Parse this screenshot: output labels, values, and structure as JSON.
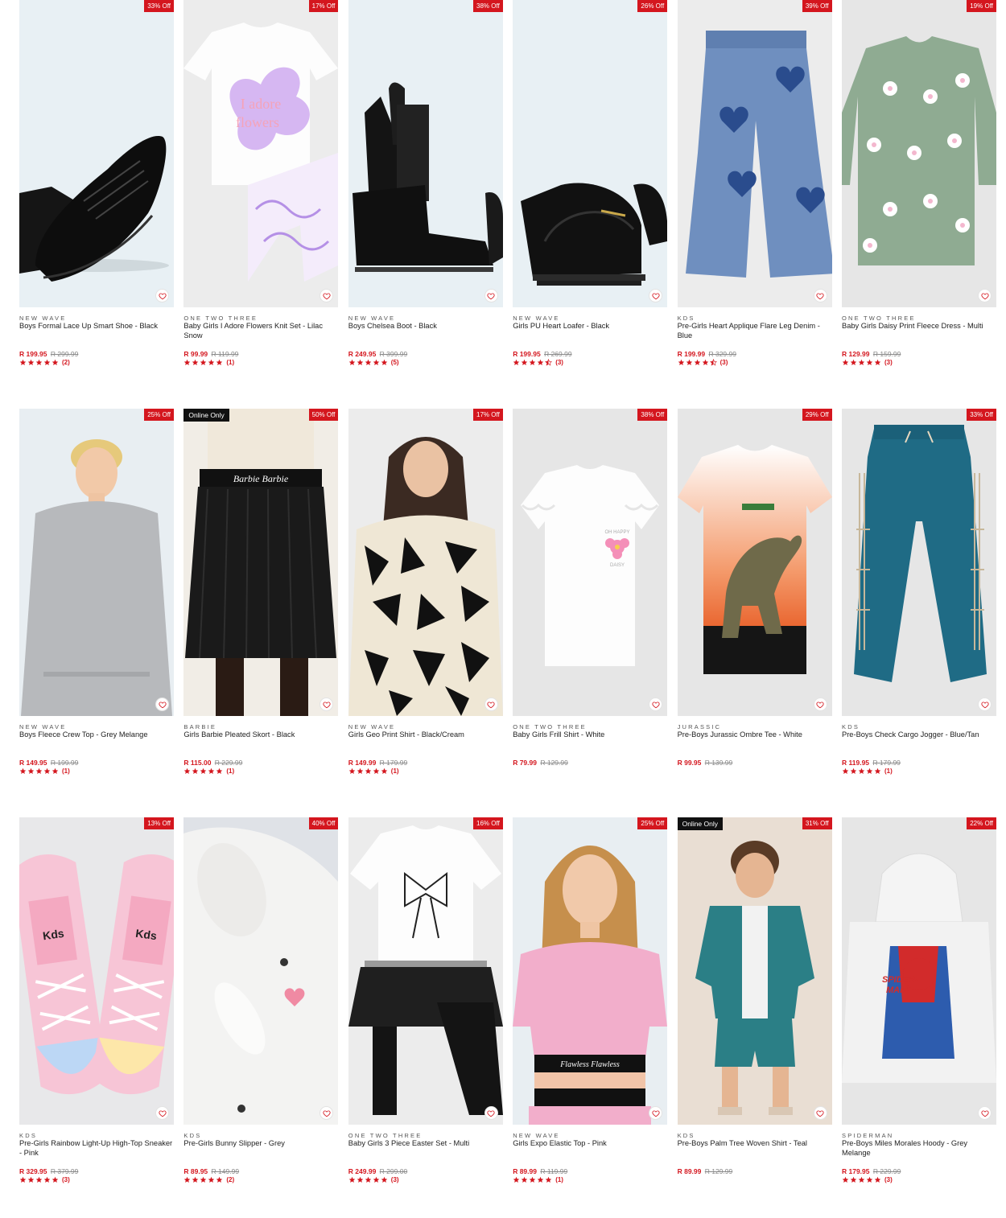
{
  "colors": {
    "accent": "#d4161e",
    "badge_dark": "#111111",
    "strike": "#888888"
  },
  "icons": {
    "wishlist": "heart-outline-icon",
    "rating": "star-icon"
  },
  "products": [
    [
      {
        "brand": "NEW WAVE",
        "name": "Boys Formal Lace Up Smart Shoe - Black",
        "price": "R 199.95",
        "was": "R 299.99",
        "discount": "33% Off",
        "online": "",
        "rating": 5,
        "reviews": "(2)",
        "art": "shoe",
        "bg": "#e8f0f4"
      },
      {
        "brand": "ONE TWO THREE",
        "name": "Baby Girls I Adore Flowers Knit Set - Lilac Snow",
        "price": "R 99.99",
        "was": "R 119.99",
        "discount": "17% Off",
        "online": "",
        "rating": 5,
        "reviews": "(1)",
        "art": "tee-set",
        "bg": "#ececec"
      },
      {
        "brand": "NEW WAVE",
        "name": "Boys Chelsea Boot - Black",
        "price": "R 249.95",
        "was": "R 399.99",
        "discount": "38% Off",
        "online": "",
        "rating": 5,
        "reviews": "(5)",
        "art": "boot",
        "bg": "#e8f0f4"
      },
      {
        "brand": "NEW WAVE",
        "name": "Girls PU Heart Loafer - Black",
        "price": "R 199.95",
        "was": "R 269.99",
        "discount": "26% Off",
        "online": "",
        "rating": 4.5,
        "reviews": "(3)",
        "art": "loafer",
        "bg": "#e8f0f4"
      },
      {
        "brand": "KDS",
        "name": "Pre-Girls Heart Applique Flare Leg Denim - Blue",
        "price": "R 199.99",
        "was": "R 329.99",
        "discount": "39% Off",
        "online": "",
        "rating": 4.5,
        "reviews": "(3)",
        "art": "jeans",
        "bg": "#ececec"
      },
      {
        "brand": "ONE TWO THREE",
        "name": "Baby Girls Daisy Print Fleece Dress - Multi",
        "price": "R 129.99",
        "was": "R 159.99",
        "discount": "19% Off",
        "online": "",
        "rating": 5,
        "reviews": "(3)",
        "art": "daisy",
        "bg": "#e6e6e6"
      }
    ],
    [
      {
        "brand": "NEW WAVE",
        "name": "Boys Fleece Crew Top - Grey Melange",
        "price": "R 149.95",
        "was": "R 199.99",
        "discount": "25% Off",
        "online": "",
        "rating": 5,
        "reviews": "(1)",
        "art": "model-grey",
        "bg": "#e8eef2"
      },
      {
        "brand": "BARBIE",
        "name": "Girls Barbie Pleated Skort - Black",
        "price": "R 115.00",
        "was": "R 229.99",
        "discount": "50% Off",
        "online": "Online Only",
        "rating": 5,
        "reviews": "(1)",
        "art": "skort",
        "bg": "#f1ede6"
      },
      {
        "brand": "NEW WAVE",
        "name": "Girls Geo Print Shirt - Black/Cream",
        "price": "R 149.99",
        "was": "R 179.99",
        "discount": "17% Off",
        "online": "",
        "rating": 5,
        "reviews": "(1)",
        "art": "geo",
        "bg": "#ececec"
      },
      {
        "brand": "ONE TWO THREE",
        "name": "Baby Girls Frill Shirt - White",
        "price": "R 79.99",
        "was": "R 129.99",
        "discount": "38% Off",
        "online": "",
        "rating": 0,
        "reviews": "",
        "art": "frill",
        "bg": "#e6e6e6"
      },
      {
        "brand": "JURASSIC",
        "name": "Pre-Boys Jurassic Ombre Tee - White",
        "price": "R 99.95",
        "was": "R 139.99",
        "discount": "29% Off",
        "online": "",
        "rating": 0,
        "reviews": "",
        "art": "dino",
        "bg": "#e6e6e6"
      },
      {
        "brand": "KDS",
        "name": "Pre-Boys Check Cargo Jogger - Blue/Tan",
        "price": "R 119.95",
        "was": "R 179.99",
        "discount": "33% Off",
        "online": "",
        "rating": 5,
        "reviews": "(1)",
        "art": "jogger",
        "bg": "#e6e6e6"
      }
    ],
    [
      {
        "brand": "KDS",
        "name": "Pre-Girls Rainbow Light-Up High-Top Sneaker - Pink",
        "price": "R 329.95",
        "was": "R 379.99",
        "discount": "13% Off",
        "online": "",
        "rating": 5,
        "reviews": "(3)",
        "art": "sneaker",
        "bg": "#e8e8ea"
      },
      {
        "brand": "KDS",
        "name": "Pre-Girls Bunny Slipper - Grey",
        "price": "R 89.95",
        "was": "R 149.99",
        "discount": "40% Off",
        "online": "",
        "rating": 5,
        "reviews": "(2)",
        "art": "bunny",
        "bg": "#e9ebef"
      },
      {
        "brand": "ONE TWO THREE",
        "name": "Baby Girls 3 Piece Easter Set - Multi",
        "price": "R 249.99",
        "was": "R 299.00",
        "discount": "16% Off",
        "online": "",
        "rating": 5,
        "reviews": "(3)",
        "art": "easter",
        "bg": "#ececec"
      },
      {
        "brand": "NEW WAVE",
        "name": "Girls Expo Elastic Top - Pink",
        "price": "R 89.99",
        "was": "R 119.99",
        "discount": "25% Off",
        "online": "",
        "rating": 5,
        "reviews": "(1)",
        "art": "pink-top",
        "bg": "#e8eef2"
      },
      {
        "brand": "KDS",
        "name": "Pre-Boys Palm Tree Woven Shirt - Teal",
        "price": "R 89.99",
        "was": "R 129.99",
        "discount": "31% Off",
        "online": "Online Only",
        "rating": 0,
        "reviews": "",
        "art": "palm",
        "bg": "#e9ded3"
      },
      {
        "brand": "SPIDERMAN",
        "name": "Pre-Boys Miles Morales Hoody - Grey Melange",
        "price": "R 179.95",
        "was": "R 229.99",
        "discount": "22% Off",
        "online": "",
        "rating": 5,
        "reviews": "(3)",
        "art": "spidey",
        "bg": "#e6e6e6"
      }
    ]
  ]
}
